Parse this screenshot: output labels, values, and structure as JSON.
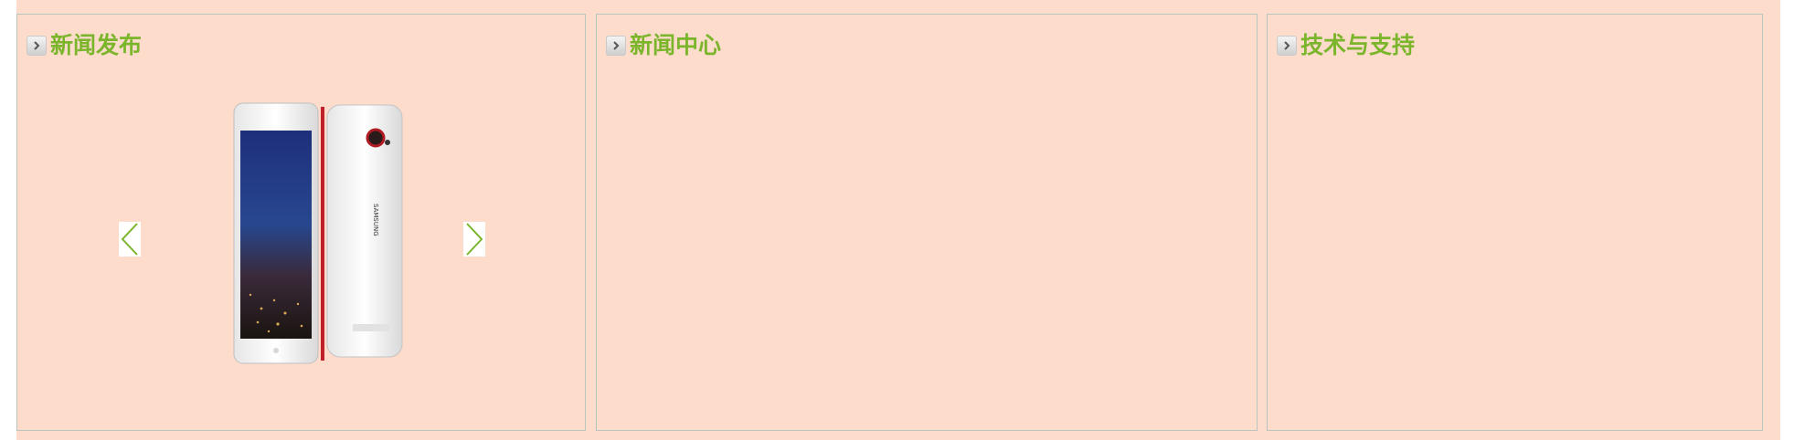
{
  "panels": [
    {
      "title": "新闻发布",
      "icon": "chevron-right-icon"
    },
    {
      "title": "新闻中心",
      "icon": "chevron-right-icon"
    },
    {
      "title": "技术与支持",
      "icon": "chevron-right-icon"
    }
  ],
  "slider": {
    "prev_icon": "chevron-left-icon",
    "next_icon": "chevron-right-icon",
    "image": "phone-product-image"
  },
  "colors": {
    "background": "#fddccb",
    "title": "#7ab52b",
    "border": "#b9c4bf"
  }
}
